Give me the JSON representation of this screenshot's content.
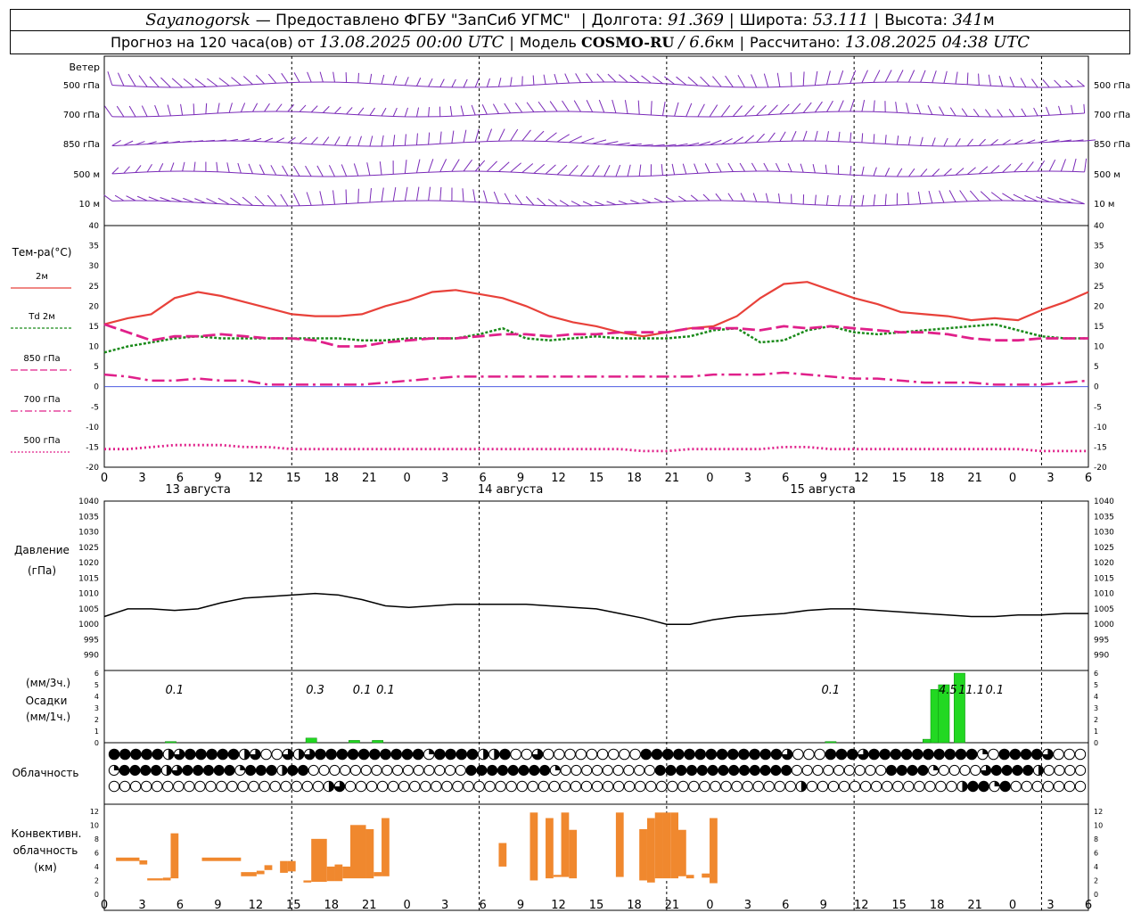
{
  "header": {
    "city": "Sayanogorsk",
    "provider": "— Предоставлено ФГБУ \"ЗапСиб УГМС\"",
    "lon_label": "Долгота:",
    "lon_value": "91.369",
    "lat_label": "Широта:",
    "lat_value": "53.111",
    "alt_label": "Высота:",
    "alt_value": "341",
    "alt_unit": "м",
    "forecast_prefix": "Прогноз на 120 часа(ов) от",
    "forecast_time": "13.08.2025 00:00 UTC",
    "model_label": "Модель",
    "model_name": "COSMO-RU",
    "model_res": "/ 6.6",
    "model_unit": "км",
    "calc_label": "Рассчитано:",
    "calc_time": "13.08.2025 04:38 UTC"
  },
  "labels": {
    "wind": "Ветер",
    "wind_levels": [
      "500 гПа",
      "700 гПа",
      "850 гПа",
      "500 м",
      "10 м"
    ],
    "temp_title": "Тем-ра(°C)",
    "temp_legend": [
      "2м",
      "Td 2м",
      "850 гПа",
      "700 гПа",
      "500 гПа"
    ],
    "pressure_title": "Давление",
    "pressure_unit": "(гПа)",
    "precip_unit3": "(мм/3ч.)",
    "precip_title": "Осадки",
    "precip_unit1": "(мм/1ч.)",
    "cloud_title": "Облачность",
    "conv_title1": "Конвективн.",
    "conv_title2": "облачность",
    "conv_unit": "(км)"
  },
  "time_axis": {
    "hour_labels": [
      "0",
      "3",
      "6",
      "9",
      "12",
      "15",
      "18",
      "21",
      "0",
      "3",
      "6",
      "9",
      "12",
      "15",
      "18",
      "21",
      "0",
      "3",
      "6",
      "9",
      "12",
      "15",
      "18",
      "21",
      "0",
      "3",
      "6"
    ],
    "day_labels": [
      "13 августа",
      "14 августа",
      "15 августа"
    ]
  },
  "colors": {
    "t2m": "#e8413a",
    "td2m": "#1a8a1a",
    "t850": "#e0208a",
    "t700": "#e0208a",
    "t500": "#e0208a",
    "wind": "#7a2ab8",
    "precip": "#22d822",
    "conv": "#f0882e",
    "pressure": "#000000"
  },
  "chart_data": [
    {
      "type": "line",
      "name": "temperature",
      "x_hours": [
        0,
        3,
        6,
        9,
        12,
        15,
        18,
        21,
        24,
        27,
        30,
        33,
        36,
        39,
        42,
        45,
        48,
        51,
        54,
        57,
        60,
        63,
        66,
        69,
        72,
        75,
        78,
        81,
        84,
        87,
        90,
        93,
        96,
        99,
        102,
        105,
        108,
        111,
        114,
        117,
        120,
        123,
        126
      ],
      "ylim": [
        -20,
        40
      ],
      "series": [
        {
          "name": "2м",
          "values": [
            15.5,
            17,
            18,
            22,
            23.5,
            22.5,
            21,
            19.5,
            18,
            17.5,
            17.5,
            18,
            20,
            21.5,
            23.5,
            24,
            23,
            22,
            20,
            17.5,
            16,
            15,
            13.5,
            12.5,
            13.5,
            14.5,
            15,
            17.5,
            22,
            25.5,
            26,
            24,
            22,
            20.5,
            18.5,
            18,
            17.5,
            16.5,
            17,
            16.5,
            19,
            21,
            23.5
          ]
        },
        {
          "name": "Td 2м",
          "values": [
            8.5,
            10,
            11,
            12,
            12.5,
            12,
            12,
            12,
            12,
            12,
            12,
            11.5,
            11.5,
            12,
            12,
            12,
            13,
            14.5,
            12,
            11.5,
            12,
            12.5,
            12,
            12,
            12,
            12.5,
            14,
            14.5,
            11,
            11.5,
            14,
            15,
            13.5,
            13,
            13.5,
            14,
            14.5,
            15,
            15.5,
            14,
            12.5,
            12,
            12
          ]
        },
        {
          "name": "850 гПа",
          "values": [
            15.5,
            13.5,
            11.5,
            12.5,
            12.5,
            13,
            12.5,
            12,
            12,
            11.5,
            10,
            10,
            11,
            11.5,
            12,
            12,
            12.5,
            13,
            13,
            12.5,
            13,
            13,
            13.5,
            13.5,
            13.5,
            14.5,
            14.5,
            14.5,
            14,
            15,
            14.5,
            15,
            14.5,
            14,
            13.5,
            13.5,
            13,
            12,
            11.5,
            11.5,
            12,
            12,
            12
          ]
        },
        {
          "name": "700 гПа",
          "values": [
            3,
            2.5,
            1.5,
            1.5,
            2,
            1.5,
            1.5,
            0.5,
            0.5,
            0.5,
            0.5,
            0.5,
            1,
            1.5,
            2,
            2.5,
            2.5,
            2.5,
            2.5,
            2.5,
            2.5,
            2.5,
            2.5,
            2.5,
            2.5,
            2.5,
            3,
            3,
            3,
            3.5,
            3,
            2.5,
            2,
            2,
            1.5,
            1,
            1,
            1,
            0.5,
            0.5,
            0.5,
            1,
            1.5
          ]
        },
        {
          "name": "500 гПа",
          "values": [
            -15.5,
            -15.5,
            -15,
            -14.5,
            -14.5,
            -14.5,
            -15,
            -15,
            -15.5,
            -15.5,
            -15.5,
            -15.5,
            -15.5,
            -15.5,
            -15.5,
            -15.5,
            -15.5,
            -15.5,
            -15.5,
            -15.5,
            -15.5,
            -15.5,
            -15.5,
            -16,
            -16,
            -15.5,
            -15.5,
            -15.5,
            -15.5,
            -15,
            -15,
            -15.5,
            -15.5,
            -15.5,
            -15.5,
            -15.5,
            -15.5,
            -15.5,
            -15.5,
            -15.5,
            -16,
            -16,
            -16
          ]
        }
      ]
    },
    {
      "type": "line",
      "name": "pressure",
      "x_hours": [
        0,
        3,
        6,
        9,
        12,
        15,
        18,
        21,
        24,
        27,
        30,
        33,
        36,
        39,
        42,
        45,
        48,
        51,
        54,
        57,
        60,
        63,
        66,
        69,
        72,
        75,
        78,
        81,
        84,
        87,
        90,
        93,
        96,
        99,
        102,
        105,
        108,
        111,
        114,
        117,
        120,
        123,
        126
      ],
      "ylim": [
        985,
        1040
      ],
      "values": [
        1002.5,
        1005,
        1005,
        1004.5,
        1005,
        1007,
        1008.5,
        1009,
        1009.5,
        1010,
        1009.5,
        1008,
        1006,
        1005.5,
        1006,
        1006.5,
        1006.5,
        1006.5,
        1006.5,
        1006,
        1005.5,
        1005,
        1003.5,
        1002,
        1000,
        1000,
        1001.5,
        1002.5,
        1003,
        1003.5,
        1004.5,
        1005,
        1005,
        1004.5,
        1004,
        1003.5,
        1003,
        1002.5,
        1002.5,
        1003,
        1003,
        1003.5,
        1003.5
      ]
    },
    {
      "type": "bar",
      "name": "precipitation",
      "ylim": [
        0,
        6
      ],
      "bars_3h_hours": [
        9,
        27,
        33,
        36,
        93,
        108,
        111,
        114
      ],
      "bars_3h_values": [
        0.1,
        0.3,
        0.1,
        0.1,
        0.1,
        4.5,
        11.1,
        0.1
      ],
      "bars_3h_labels": [
        "0.1",
        "0.3",
        "0.1",
        "0.1",
        "0.1",
        "4.5",
        "11.1",
        "0.1"
      ],
      "bars_1h": [
        {
          "hour": 8.5,
          "value": 0.1
        },
        {
          "hour": 26.5,
          "value": 0.4
        },
        {
          "hour": 32,
          "value": 0.2
        },
        {
          "hour": 35,
          "value": 0.2
        },
        {
          "hour": 93,
          "value": 0.1
        },
        {
          "hour": 105.5,
          "value": 0.3
        },
        {
          "hour": 106.5,
          "value": 4.6
        },
        {
          "hour": 107.5,
          "value": 5
        },
        {
          "hour": 109.5,
          "value": 6.5
        }
      ]
    },
    {
      "type": "bar",
      "name": "convective_cloud",
      "ylim": [
        0,
        13
      ],
      "segments": [
        {
          "h0": 1.5,
          "h1": 4.5,
          "bottom": 4.8,
          "top": 5.3
        },
        {
          "h0": 4.5,
          "h1": 5.5,
          "bottom": 4.3,
          "top": 4.9
        },
        {
          "h0": 5.5,
          "h1": 7.5,
          "bottom": 2.0,
          "top": 2.3
        },
        {
          "h0": 7.5,
          "h1": 8.5,
          "bottom": 2.0,
          "top": 2.4
        },
        {
          "h0": 8.5,
          "h1": 9.5,
          "bottom": 2.3,
          "top": 8.8
        },
        {
          "h0": 12.5,
          "h1": 17.5,
          "bottom": 4.8,
          "top": 5.3
        },
        {
          "h0": 17.5,
          "h1": 19.5,
          "bottom": 2.6,
          "top": 3.2
        },
        {
          "h0": 19.5,
          "h1": 20.5,
          "bottom": 2.9,
          "top": 3.4
        },
        {
          "h0": 20.5,
          "h1": 21.5,
          "bottom": 3.5,
          "top": 4.2
        },
        {
          "h0": 22.5,
          "h1": 23.5,
          "bottom": 3.1,
          "top": 4.8
        },
        {
          "h0": 23.5,
          "h1": 24.5,
          "bottom": 3.3,
          "top": 4.8
        },
        {
          "h0": 25.5,
          "h1": 26.5,
          "bottom": 1.7,
          "top": 2.0
        },
        {
          "h0": 26.5,
          "h1": 28.5,
          "bottom": 1.8,
          "top": 8.0
        },
        {
          "h0": 28.5,
          "h1": 29.5,
          "bottom": 1.9,
          "top": 4.0
        },
        {
          "h0": 29.5,
          "h1": 30.5,
          "bottom": 1.9,
          "top": 4.3
        },
        {
          "h0": 30.5,
          "h1": 31.5,
          "bottom": 2.3,
          "top": 4.0
        },
        {
          "h0": 31.5,
          "h1": 33.5,
          "bottom": 2.3,
          "top": 10.0
        },
        {
          "h0": 33.5,
          "h1": 34.5,
          "bottom": 2.3,
          "top": 9.4
        },
        {
          "h0": 34.5,
          "h1": 35.5,
          "bottom": 2.6,
          "top": 3.2
        },
        {
          "h0": 35.5,
          "h1": 36.5,
          "bottom": 2.6,
          "top": 11.0
        },
        {
          "h0": 50.5,
          "h1": 51.5,
          "bottom": 4.0,
          "top": 7.4
        },
        {
          "h0": 54.5,
          "h1": 55.5,
          "bottom": 2.0,
          "top": 11.8
        },
        {
          "h0": 56.5,
          "h1": 57.5,
          "bottom": 2.3,
          "top": 11.0
        },
        {
          "h0": 57.5,
          "h1": 58.5,
          "bottom": 2.5,
          "top": 2.8
        },
        {
          "h0": 58.5,
          "h1": 59.5,
          "bottom": 2.5,
          "top": 11.8
        },
        {
          "h0": 59.5,
          "h1": 60.5,
          "bottom": 2.3,
          "top": 9.3
        },
        {
          "h0": 65.5,
          "h1": 66.5,
          "bottom": 2.5,
          "top": 11.8
        },
        {
          "h0": 68.5,
          "h1": 69.5,
          "bottom": 2.0,
          "top": 9.4
        },
        {
          "h0": 69.5,
          "h1": 70.5,
          "bottom": 1.7,
          "top": 11.0
        },
        {
          "h0": 70.5,
          "h1": 71.5,
          "bottom": 2.3,
          "top": 11.8
        },
        {
          "h0": 71.5,
          "h1": 72.5,
          "bottom": 2.3,
          "top": 11.8
        },
        {
          "h0": 72.5,
          "h1": 73.5,
          "bottom": 2.3,
          "top": 11.8
        },
        {
          "h0": 73.5,
          "h1": 74.5,
          "bottom": 2.6,
          "top": 9.3
        },
        {
          "h0": 74.5,
          "h1": 75.5,
          "bottom": 2.3,
          "top": 2.8
        },
        {
          "h0": 76.5,
          "h1": 77.5,
          "bottom": 2.4,
          "top": 3.0
        },
        {
          "h0": 77.5,
          "h1": 78.5,
          "bottom": 1.6,
          "top": 11.0
        }
      ]
    }
  ],
  "cloud_rows": {
    "high": "FFFFFHCFFFFFHCOOCHCFFFFFFFFFFQFFFFHHFOOCOOOOOOOOOFFFFFFFFFFFFFCOOOFFFCFFFFFFFFFFQOFFFFCOOO",
    "mid": "QFFFFHCFFFFFQFFFHFFOOOOOOOOOOOOOOOFFFFFFFFQOOOOOOOOOFFFFFFFFFFFFFOOOOOOOOOFFFFQOOOOCFFFFHOOOO",
    "low": "OOOOOOOOOOOOOOOOOOOOHCOOOOOOOOOOOOOOOOOOOOOOOOOOOOOOOOOOOOOOOOOOHOOOOOOOOOOOOOOHFFQFOOOOOOO"
  }
}
